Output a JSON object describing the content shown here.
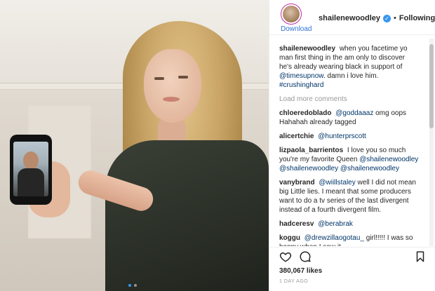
{
  "header": {
    "username": "shailenewoodley",
    "separator": "•",
    "follow_status": "Following",
    "download_label": "Download",
    "verified_mark": "✓"
  },
  "caption": {
    "user": "shailenewoodley",
    "text_1": "when you facetime yo man first thing in the am only to discover he's already wearing black in support of",
    "mention": "@timesupnow",
    "text_2": ". damn i love him.",
    "hashtag": "#crushinghard"
  },
  "load_more_label": "Load more comments",
  "comments": [
    {
      "user": "chloeredoblado",
      "mention": "@goddaaaz",
      "text": " omg oops Hahahah already tagged"
    },
    {
      "user": "alicertchie",
      "mention": "@hunterprscott",
      "text": ""
    },
    {
      "user": "lizpaola_barrientos",
      "mention": "",
      "text": "I love you so much you're my favorite Queen",
      "mention_2": "@shailenewoodley @shailenewoodley @shailenewoodley"
    },
    {
      "user": "vanybrand",
      "mention": "@wiillstaley",
      "text": " well I did not mean big Little lies. I meant that some producers want to do a tv series of the last divergent instead of a fourth divergent film."
    },
    {
      "user": "hadceresv",
      "mention": "@berabrak",
      "text": ""
    },
    {
      "user": "koggu",
      "mention": "@drewzillaogotau_",
      "text": " girl!!!!! I was so happy when I saw it"
    }
  ],
  "likes": "380,067 likes",
  "time_ago": "1 DAY AGO",
  "icons": {
    "like": "heart-icon",
    "comment": "comment-bubble-icon",
    "save": "bookmark-icon",
    "verified": "verified-badge-icon"
  },
  "colors": {
    "link": "#003569",
    "verified": "#3897f0",
    "download": "#2e73d6",
    "muted": "#999999"
  }
}
